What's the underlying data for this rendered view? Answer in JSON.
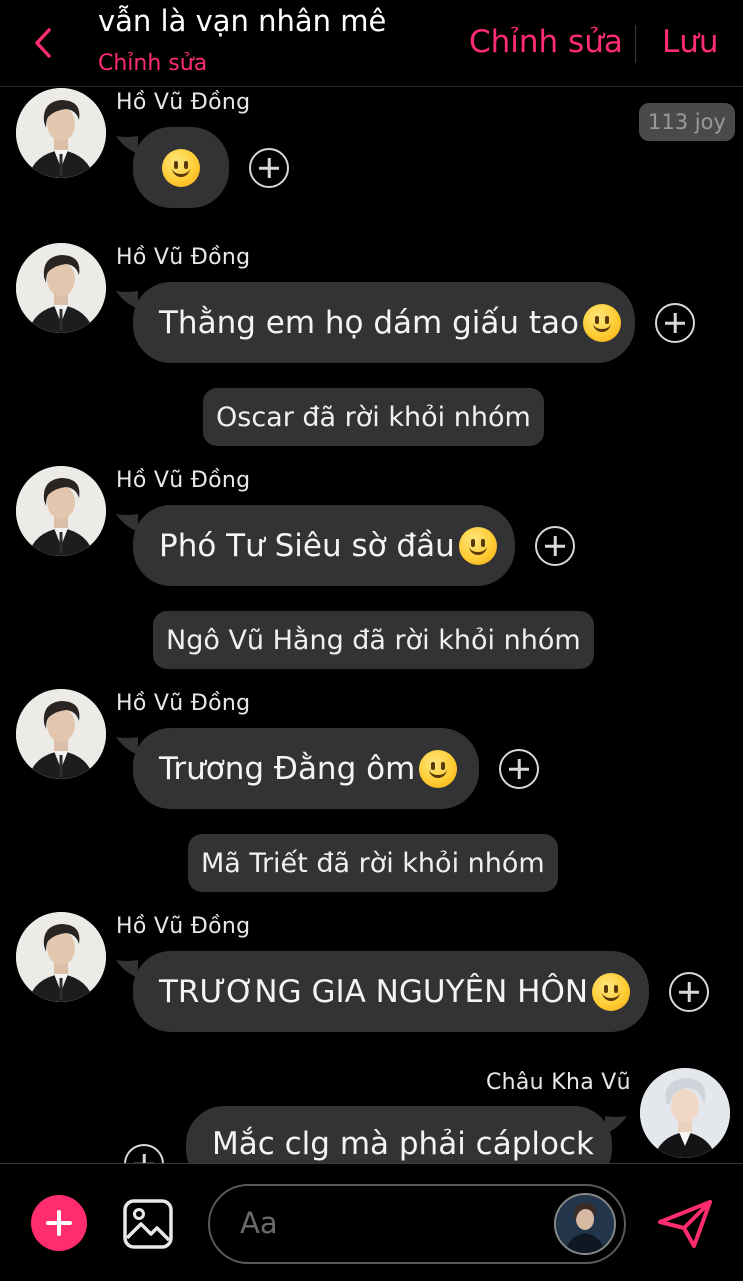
{
  "header": {
    "title": "vẫn là vạn nhân mê",
    "subtitle": "Chỉnh sửa",
    "edit_label": "Chỉnh sửa",
    "save_label": "Lưu"
  },
  "badge": {
    "text": "113 joy"
  },
  "messages": [
    {
      "sender": "Hồ Vũ Đồng",
      "text": "",
      "emoji": "slight-smile"
    },
    {
      "sender": "Hồ Vũ Đồng",
      "text": "Thằng em họ dám giấu tao ",
      "emoji": "slight-smile"
    },
    {
      "sender": "Hồ Vũ Đồng",
      "text": "Phó Tư Siêu sờ đầu",
      "emoji": "slight-smile"
    },
    {
      "sender": "Hồ Vũ Đồng",
      "text": "Trương Đằng ôm",
      "emoji": "slight-smile"
    },
    {
      "sender": "Hồ Vũ Đồng",
      "text": "TRƯƠNG GIA NGUYÊN HÔN",
      "emoji": "slight-smile"
    },
    {
      "sender": "Châu Kha Vũ",
      "text": "Mắc clg mà phải cáplock",
      "emoji": ""
    }
  ],
  "system_messages": [
    "Oscar đã rời khỏi nhóm",
    "Ngô Vũ Hằng đã rời khỏi nhóm",
    "Mã Triết đã rời khỏi nhóm"
  ],
  "composer": {
    "placeholder": "Aa"
  },
  "icons": {
    "back": "chevron-left-icon",
    "add": "plus-icon",
    "image": "image-icon",
    "send": "send-icon",
    "react": "add-reaction-icon"
  },
  "colors": {
    "accent": "#ff2d6e",
    "bubble": "#333336",
    "background": "#000000"
  }
}
